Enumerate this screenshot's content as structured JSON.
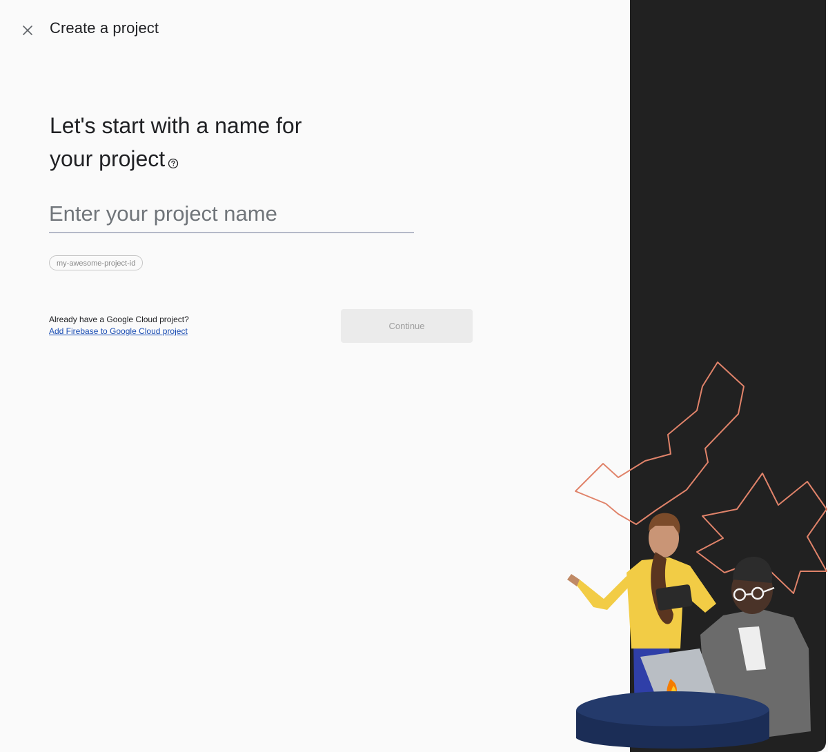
{
  "header": {
    "close_icon": "close-icon",
    "title": "Create a project"
  },
  "main": {
    "heading_line1": "Let's start with a name for",
    "heading_line2": "your project",
    "help_icon": "help-circle-icon",
    "name_input": {
      "placeholder": "Enter your project name",
      "value": ""
    },
    "project_id": "my-awesome-project-id",
    "cloud_question": "Already have a Google Cloud project?",
    "cloud_link": "Add Firebase to Google Cloud project",
    "continue_label": "Continue"
  },
  "colors": {
    "dark_panel": "#212121",
    "accent_outline": "#e0836a",
    "link": "#1a4db3",
    "button_disabled_bg": "#ebebeb"
  }
}
